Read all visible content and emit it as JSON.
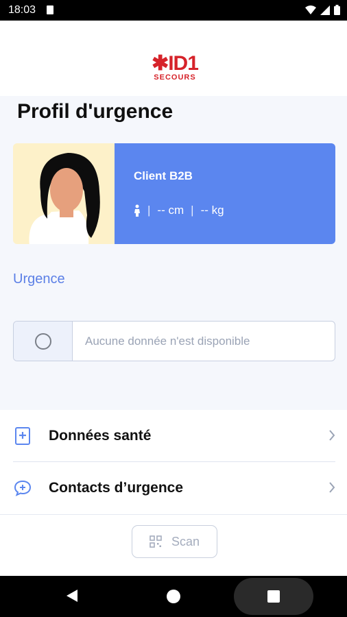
{
  "status_bar": {
    "time": "18:03"
  },
  "logo": {
    "mark": "✱ID1",
    "sub": "SECOURS"
  },
  "page": {
    "title": "Profil d'urgence"
  },
  "profile": {
    "name": "Client B2B",
    "height": "-- cm",
    "weight": "-- kg",
    "separator": "|"
  },
  "urgence": {
    "label": "Urgence",
    "empty_message": "Aucune donnée n'est disponible"
  },
  "menu": {
    "items": [
      {
        "label": "Données santé",
        "icon": "health-record-icon"
      },
      {
        "label": "Contacts d’urgence",
        "icon": "chat-plus-icon"
      }
    ]
  },
  "bottom": {
    "scan_label": "Scan"
  },
  "colors": {
    "accent": "#5b86ef",
    "brand_red": "#d6232a",
    "avatar_bg": "#fdf1c9"
  }
}
